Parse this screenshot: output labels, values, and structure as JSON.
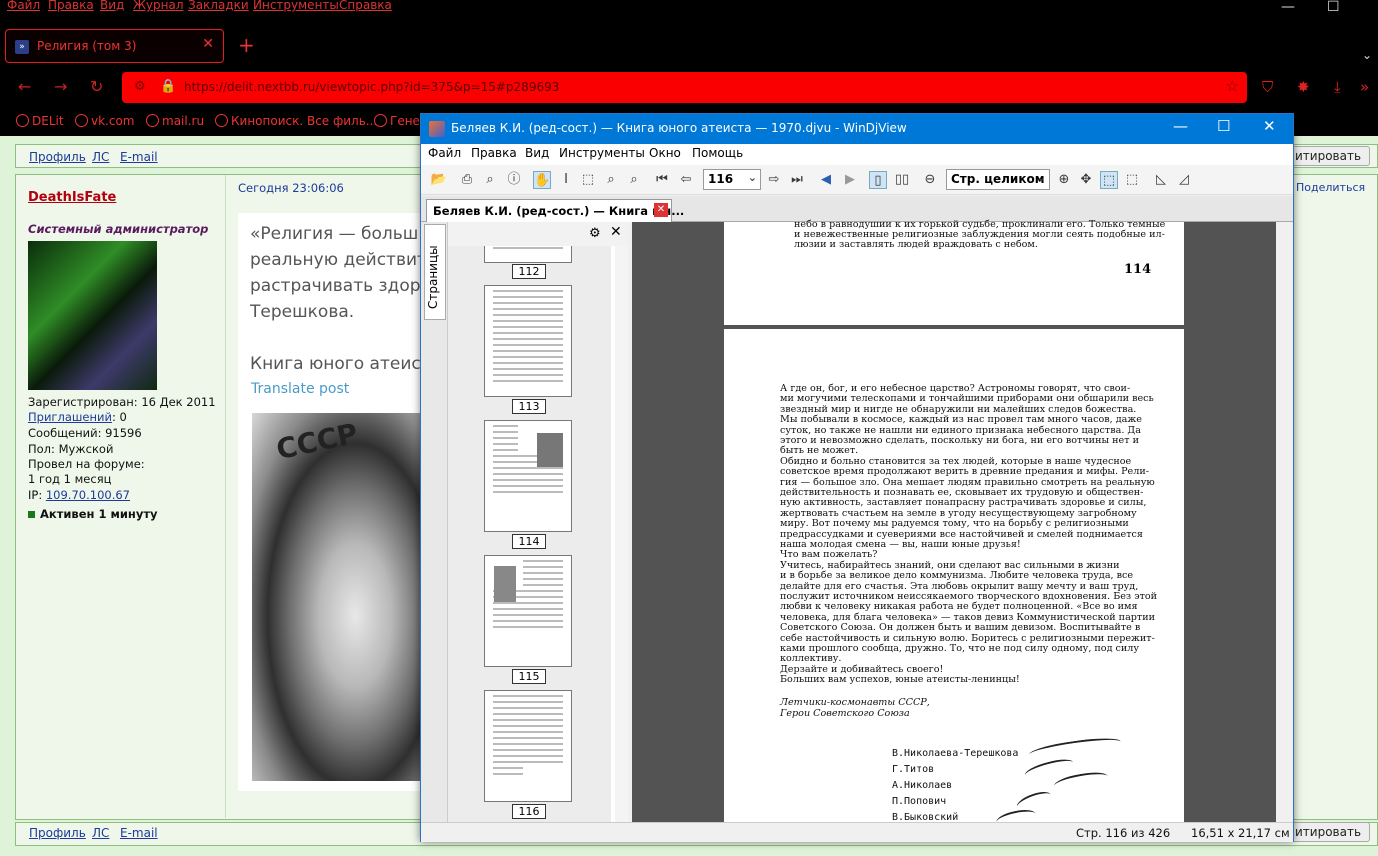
{
  "browser": {
    "menu": [
      "Файл",
      "Правка",
      "Вид",
      "Журнал",
      "Закладки",
      "Инструменты",
      "Справка"
    ],
    "tab_title": "Религия (том 3)",
    "url": "https://delit.nextbb.ru/viewtopic.php?id=375&p=15#p289693",
    "bookmarks": [
      "DELit",
      "vk.com",
      "mail.ru",
      "Кинопоиск. Все филь...",
      "Гене"
    ]
  },
  "forum": {
    "profile_links": [
      "Профиль",
      "ЛС",
      "E-mail"
    ],
    "quote_button": "итировать",
    "share": "Поделиться",
    "post_time": "Сегодня 23:06:06",
    "username": "DeathIsFate",
    "rank": "Системный администратор",
    "registered": "Зарегистрирован: 16 Дек 2011",
    "invitations_label": "Приглашений",
    "invitations_value": ": 0",
    "messages": "Сообщений: 91596",
    "gender": "Пол: Мужской",
    "time_on_forum_label": "Провел на форуме:",
    "time_on_forum_value": "1 год 1 месяц",
    "ip_label": "IP: ",
    "ip": "109.70.100.67",
    "active": "Активен 1 минуту",
    "quote_lines": [
      "«Религия — больш",
      "реальную действит",
      "растрачивать здоро",
      "Терешкова."
    ],
    "book_line": "Книга юного атеист",
    "translate": "Translate post",
    "photo_text": "СССР"
  },
  "djvu": {
    "title": "Беляев К.И. (ред-сост.) —  Книга юного атеиста — 1970.djvu - WinDjView",
    "menu": [
      "Файл",
      "Правка",
      "Вид",
      "Инструменты",
      "Окно",
      "Помощь"
    ],
    "page_field": "116",
    "zoom_field": "Стр. целиком",
    "doc_tab": "Беляев К.И. (ред-сост.) —  Книга юн...",
    "side_tab": "Страницы",
    "thumb_labels": [
      "112",
      "113",
      "114",
      "115",
      "116"
    ],
    "page114_top_lines": [
      "небо в равнодушии к их горькой судьбе, проклинали его. Только темные",
      "и невежественные религиозные заблуждения могли сеять подобные ил-",
      "люзии и заставлять людей враждовать с небом."
    ],
    "page114_number": "114",
    "page116_lines": [
      "    А где он, бог, и его небесное царство? Астрономы говорят, что свои-",
      "ми могучими телескопами и тончайшими приборами они обшарили весь",
      "звездный мир и нигде не обнаружили ни малейших следов божества.",
      "Мы побывали в космосе, каждый из нас провел там много часов, даже",
      "суток, но также не нашли ни единого признака небесного царства. Да",
      "этого и невозможно сделать, поскольку ни бога, ни его вотчины нет и",
      "быть не может.",
      "    Обидно и больно становится за тех людей, которые в наше чудесное",
      "советское время продолжают верить в древние предания и мифы. Рели-",
      "гия — большое зло. Она мешает людям правильно смотреть на реальную",
      "действительность и познавать ее, сковывает их трудовую и обществен-",
      "ную активность, заставляет понапрасну растрачивать здоровье и силы,",
      "жертвовать счастьем на земле в угоду несуществующему загробному",
      "миру. Вот почему мы радуемся тому, что на борьбу с религиозными",
      "предрассудками и суевериями все настойчивей и смелей поднимается",
      "наша молодая смена — вы, наши юные друзья!",
      "    Что вам пожелать?",
      "    Учитесь, набирайтесь знаний, они сделают вас сильными в жизни",
      "и в борьбе за великое дело коммунизма. Любите человека труда, все",
      "делайте для его счастья. Эта любовь окрылит вашу мечту и ваш труд,",
      "послужит источником неиссякаемого творческого вдохновения. Без этой",
      "любви к человеку никакая работа не будет полноценной. «Все во имя",
      "человека, для блага человека» — таков девиз Коммунистической партии",
      "Советского Союза. Он должен быть и вашим девизом. Воспитывайте в",
      "себе настойчивость и сильную волю. Боритесь с религиозными пережит-",
      "ками прошлого сообща, дружно. То, что не под силу одному, под силу",
      "коллективу.",
      "    Дерзайте и добивайтесь своего!",
      "    Больших вам успехов, юные атеисты-ленинцы!"
    ],
    "signoff_lines": [
      "Летчики-космонавты СССР,",
      "Герои Советского Союза"
    ],
    "signatories": [
      "В.Николаева-Терешкова",
      "Г.Титов",
      "А.Николаев",
      "П.Попович",
      "В.Быковский"
    ],
    "status_page": "Стр. 116 из 426",
    "status_size": "16,51 x 21,17 см"
  }
}
